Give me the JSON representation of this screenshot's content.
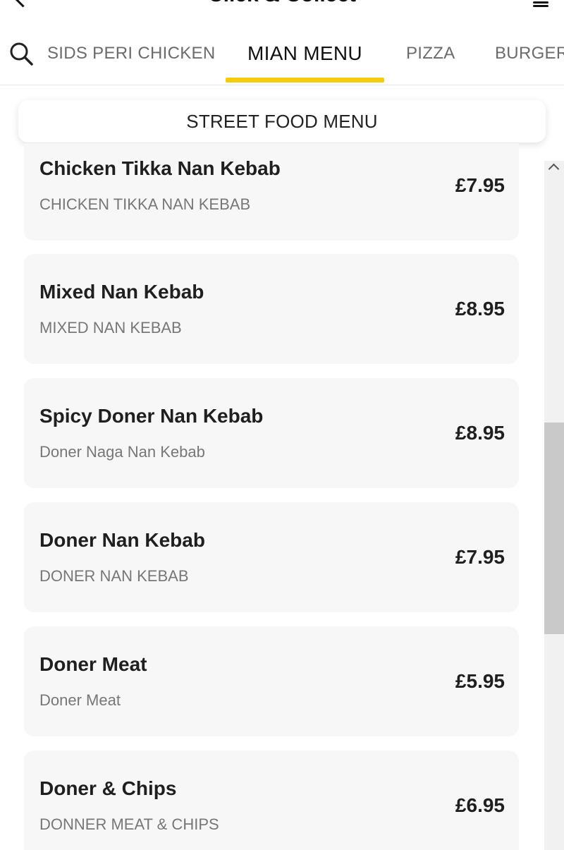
{
  "header": {
    "title": "Click & Collect"
  },
  "tabs": [
    {
      "label": "SIDS PERI CHICKEN"
    },
    {
      "label": "MIAN MENU"
    },
    {
      "label": "PIZZA"
    },
    {
      "label": "BURGER"
    }
  ],
  "subcategory": "STREET FOOD MENU",
  "items": [
    {
      "name": "Chicken Tikka Nan Kebab",
      "desc": "CHICKEN TIKKA NAN KEBAB",
      "price": "£7.95"
    },
    {
      "name": "Mixed Nan Kebab",
      "desc": "MIXED NAN KEBAB",
      "price": "£8.95"
    },
    {
      "name": "Spicy Doner Nan Kebab",
      "desc": "Doner Naga Nan Kebab",
      "price": "£8.95"
    },
    {
      "name": "Doner Nan Kebab",
      "desc": "DONER NAN KEBAB",
      "price": "£7.95"
    },
    {
      "name": "Doner Meat",
      "desc": "Doner Meat",
      "price": "£5.95"
    },
    {
      "name": "Doner & Chips",
      "desc": "DONNER MEAT & CHIPS",
      "price": "£6.95"
    }
  ],
  "colors": {
    "accent": "#f5cc0a",
    "card_bg": "#f7f7f7"
  }
}
